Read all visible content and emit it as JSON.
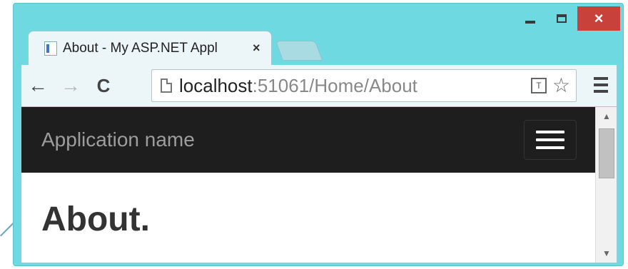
{
  "window": {
    "controls": {
      "minimize": "",
      "maximize": "",
      "close": "×"
    }
  },
  "tabs": [
    {
      "title": "About - My ASP.NET Appl",
      "close": "×"
    }
  ],
  "toolbar": {
    "back_icon": "←",
    "forward_icon": "→",
    "reload_icon": "C",
    "url_host": "localhost",
    "url_path": ":51061/Home/About",
    "translate_icon": "T",
    "star_icon": "☆"
  },
  "page": {
    "brand": "Application name",
    "heading": "About."
  },
  "scrollbar": {
    "up": "▲",
    "down": "▼"
  },
  "colors": {
    "window_frame": "#6fd9e2",
    "close_button": "#c8413b",
    "navbar_bg": "#1e1e1e",
    "brand_text": "#9d9d9d"
  }
}
